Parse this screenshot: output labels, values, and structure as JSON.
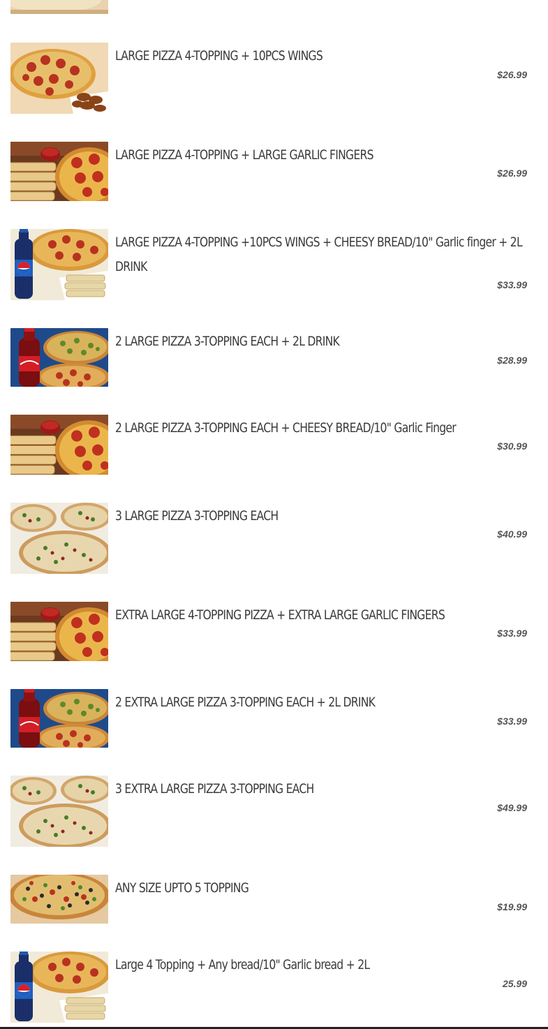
{
  "menu_items": [
    {
      "title": "LARGE PIZZA 4-TOPPING + 10PCS WINGS",
      "price": "$26.99",
      "image": "pepperoni-pizza-with-wings"
    },
    {
      "title": "LARGE PIZZA 4-TOPPING + LARGE GARLIC FINGERS",
      "price": "$26.99",
      "image": "pizza-with-garlic-fingers"
    },
    {
      "title": "LARGE PIZZA 4-TOPPING +10PCS WINGS + CHEESY BREAD/10\" Garlic finger + 2L DRINK",
      "price": "$33.99",
      "image": "pizza-with-pepsi-and-bread"
    },
    {
      "title": "2 LARGE PIZZA 3-TOPPING EACH + 2L DRINK",
      "price": "$28.99",
      "image": "two-pizzas-with-coca-cola"
    },
    {
      "title": "2 LARGE PIZZA 3-TOPPING EACH + CHEESY BREAD/10\" Garlic Finger",
      "price": "$30.99",
      "image": "pizza-with-garlic-fingers"
    },
    {
      "title": "3 LARGE PIZZA 3-TOPPING EACH",
      "price": "$40.99",
      "image": "three-pizzas"
    },
    {
      "title": "EXTRA LARGE 4-TOPPING PIZZA + EXTRA LARGE GARLIC FINGERS",
      "price": "$33.99",
      "image": "pizza-with-garlic-fingers"
    },
    {
      "title": "2 EXTRA LARGE PIZZA 3-TOPPING EACH + 2L DRINK",
      "price": "$33.99",
      "image": "two-pizzas-with-coca-cola"
    },
    {
      "title": "3 EXTRA LARGE PIZZA 3-TOPPING EACH",
      "price": "$49.99",
      "image": "three-pizzas"
    },
    {
      "title": "ANY SIZE UPTO 5 TOPPING",
      "price": "$19.99",
      "image": "supreme-pizza"
    },
    {
      "title": "Large 4 Topping + Any bread/10\" Garlic bread + 2L",
      "price": "25.99",
      "image": "pizza-with-pepsi-and-bread"
    }
  ]
}
